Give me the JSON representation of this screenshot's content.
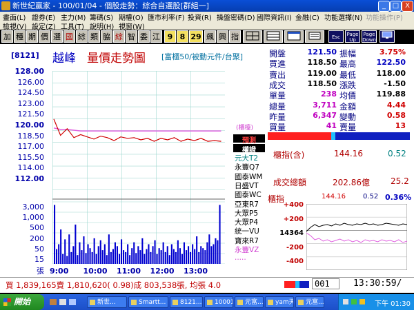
{
  "window": {
    "title": "新世紀贏家 - 100/01/04 - 個股走勢：綜合自選股[群組一]",
    "buttons": {
      "min": "_",
      "max": "□",
      "close": "X"
    }
  },
  "menu": {
    "row1": [
      "畫面(L)",
      "證券(E)",
      "主力(M)",
      "籌碼(S)",
      "期權(O)",
      "匯市利率(F)",
      "投資(R)",
      "操盤密碼(D)",
      "國際資訊(I)",
      "金融(C)",
      "功能選擇(N)",
      "功能操作(P)"
    ],
    "row2": [
      "檢視(V)",
      "設定(Z)",
      "工具(T)",
      "說明(H)",
      "視窗(W)"
    ]
  },
  "toolbar": {
    "buttons": [
      "加",
      "種",
      "期",
      "價",
      "選",
      "國",
      "綜",
      "類",
      "脇",
      "綜",
      "智",
      "委",
      "江",
      "9",
      "8",
      "29",
      "飆",
      "興",
      "指"
    ],
    "icons": [
      "Esc",
      "Page Up",
      "Page Down"
    ]
  },
  "stock": {
    "code": "[8121]",
    "name": "越峰",
    "chart_title": "量價走勢圖",
    "category": "[富櫃50/被動元件/台聚]"
  },
  "price_axis": [
    "128.00",
    "126.00",
    "124.50",
    "123.00",
    "121.50",
    "120.00",
    "118.50",
    "117.00",
    "115.50",
    "114.00",
    "112.00"
  ],
  "volume_axis": [
    "3,000",
    "1,000",
    "500",
    "200",
    "50",
    "15",
    "張"
  ],
  "time_axis": [
    "9:00",
    "10:00",
    "11:00",
    "12:00",
    "13:00"
  ],
  "ref_label": "(櫃檯)",
  "side_list": {
    "highlight1": "預測",
    "highlight2": "權證",
    "items": [
      "元大T2",
      "永豐Q7",
      "國泰WM",
      "日盛VT",
      "國泰WC",
      "亞東R7",
      "大眾P5",
      "大眾P4",
      "統一VU",
      "寶來R7",
      "永豐VZ",
      "....."
    ]
  },
  "quote": {
    "rows": [
      {
        "l1": "開盤",
        "v1": "121.50",
        "c1": "#0000c0",
        "l2": "振幅",
        "v2": "3.75%",
        "c2": "#d00000"
      },
      {
        "l1": "買進",
        "v1": "118.50",
        "c1": "#000000",
        "l2": "最高",
        "v2": "122.50",
        "c2": "#0000c0"
      },
      {
        "l1": "賣出",
        "v1": "119.00",
        "c1": "#000000",
        "l2": "最低",
        "v2": "118.00",
        "c2": "#000000"
      },
      {
        "l1": "成交",
        "v1": "118.50",
        "c1": "#000000",
        "l2": "漲跌",
        "v2": "-1.50",
        "c2": "#000000"
      },
      {
        "l1": "單量",
        "v1": "238",
        "c1": "#c000c0",
        "l2": "均價",
        "v2": "119.88",
        "c2": "#000000"
      },
      {
        "l1": "總量",
        "v1": "3,711",
        "c1": "#c000c0",
        "l2": "金額",
        "v2": "4.44",
        "c2": "#d00000"
      },
      {
        "l1": "昨量",
        "v1": "6,347",
        "c1": "#c000c0",
        "l2": "變動",
        "v2": "0.58",
        "c2": "#d00000"
      },
      {
        "l1": "買量",
        "v1": "41",
        "c1": "#c000c0",
        "l2": "賣量",
        "v2": "13",
        "c2": "#d00000"
      }
    ]
  },
  "index_panel": {
    "label": "櫃指(含)",
    "value": "144.16",
    "change": "0.52",
    "turnover_label": "成交總額",
    "turnover_value": "202.86億",
    "turnover_change": "25.2"
  },
  "mini_chart": {
    "label": "櫃指",
    "price": "144.16",
    "change": "0.52",
    "pct": "0.36%",
    "axis": [
      "+400",
      "+200",
      "14364",
      "-200",
      "-400"
    ]
  },
  "status": {
    "text": "買 1,839,165賣 1,810,620( 0.98)成 803,538張, 均張 4.0",
    "code_field": "001",
    "time": "13:30:59/"
  },
  "taskbar": {
    "start": "開始",
    "tasks": [
      "新世...",
      "Smartt...",
      "8121...",
      "10001...",
      "元富...",
      "yam天...",
      "元富..."
    ],
    "clock": "下午 01:30"
  },
  "colors": {
    "price_line": "#d00000",
    "avg_line": "#e060e0",
    "volume_bar": "#0000d0",
    "grid": "#a0d8d0",
    "axis_text": "#0000aa"
  },
  "chart_data": {
    "type": "line",
    "title": "量價走勢圖",
    "x": [
      "9:00",
      "10:00",
      "11:00",
      "12:00",
      "13:00"
    ],
    "ylim": [
      112,
      128
    ],
    "series": [
      {
        "values": [
          121.5,
          119.3,
          120.2,
          119.0,
          119.4,
          119.1,
          118.8,
          119.2,
          119.0,
          118.6,
          119.1,
          118.9,
          119.0,
          118.7,
          118.9,
          118.5,
          118.9,
          118.7,
          119.0,
          118.5,
          118.8,
          118.6,
          118.9,
          118.5,
          118.6,
          118.5
        ]
      },
      {
        "values": [
          120.3,
          120.1,
          120.1,
          120.0,
          119.9,
          119.9,
          119.9,
          119.9,
          119.9,
          119.9,
          119.9,
          119.9,
          119.9,
          119.9,
          119.9,
          119.9,
          119.9,
          119.9,
          119.9,
          119.9,
          119.9,
          119.9,
          119.9,
          119.9,
          119.9,
          119.9
        ]
      }
    ],
    "volume": [
      60,
      15,
      20,
      35,
      10,
      25,
      8,
      30,
      12,
      18,
      40,
      9,
      22,
      14,
      28,
      11,
      20,
      16,
      12,
      26,
      10,
      18,
      24,
      14,
      20,
      9,
      30,
      12,
      15,
      22,
      18,
      10,
      25,
      14,
      12,
      20,
      9,
      16,
      22,
      11,
      18,
      14,
      26,
      10,
      15,
      20,
      12,
      18,
      24,
      10,
      16,
      14,
      22,
      12,
      18,
      9,
      20,
      15,
      12,
      24,
      16,
      10,
      22,
      14,
      18,
      12,
      20,
      15,
      28,
      12,
      18,
      16,
      14,
      22,
      30,
      18,
      20,
      26,
      24,
      60
    ]
  }
}
